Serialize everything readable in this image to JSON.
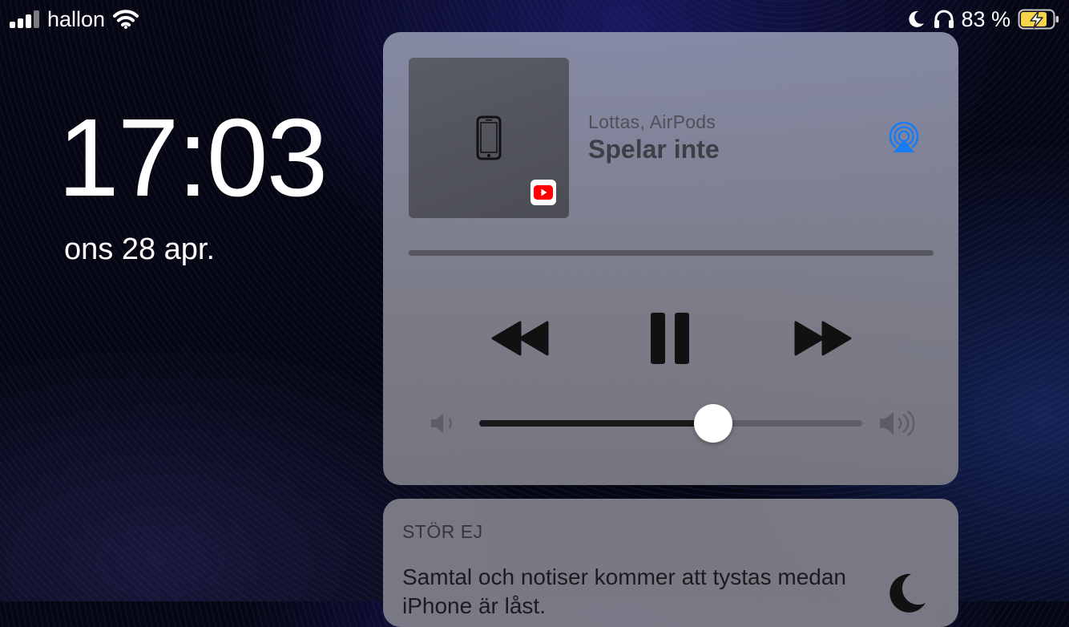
{
  "status_bar": {
    "carrier": "hallon",
    "battery_percent": "83 %",
    "battery_level": 0.83,
    "signal_bars": 3,
    "icons": [
      "signal-icon",
      "wifi-icon",
      "moon-icon",
      "headphones-icon",
      "battery-charging-icon"
    ]
  },
  "lock_screen": {
    "time": "17:03",
    "date": "ons 28 apr."
  },
  "now_playing": {
    "route": "Lottas, AirPods",
    "status": "Spelar inte",
    "progress_fraction": 0,
    "volume_fraction": 0.61,
    "source_app_icon": "youtube-icon",
    "artwork_icon": "iphone-icon",
    "accent_color": "#1a7cf5",
    "controls": [
      "rewind-icon",
      "pause-icon",
      "fast-forward-icon"
    ]
  },
  "do_not_disturb": {
    "title": "STÖR EJ",
    "message": "Samtal och notiser kommer att tystas medan iPhone är låst."
  }
}
